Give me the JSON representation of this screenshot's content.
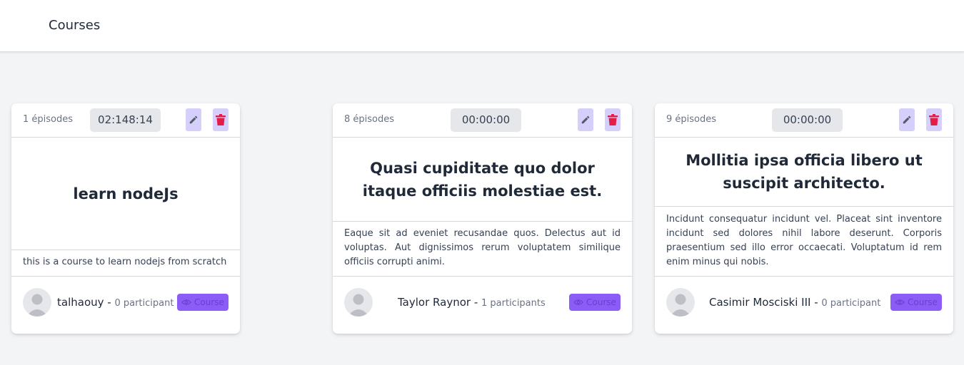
{
  "header": {
    "title": "Courses"
  },
  "colors": {
    "accent": "#8b5cf6",
    "delete": "#e11d48",
    "icon_bg": "#d4d0fb"
  },
  "icons": {
    "edit": "pencil-icon",
    "delete": "trash-icon",
    "view": "eye-icon",
    "avatar": "user-avatar-icon"
  },
  "courses": [
    {
      "episodes": "1 épisodes",
      "duration": "02:148:14",
      "title": "learn nodeJs",
      "description": "this is a course to learn nodejs from scratch",
      "author": "talhaouy",
      "separator": " - ",
      "participants": "0 participant",
      "button_label": "Course"
    },
    {
      "episodes": "8 épisodes",
      "duration": "00:00:00",
      "title": "Quasi cupiditate quo dolor itaque officiis molestiae est.",
      "description": "Eaque sit ad eveniet recusandae quos. Delectus aut id voluptas. Aut dignissimos rerum voluptatem similique officiis corrupti animi.",
      "author": "Taylor Raynor",
      "separator": " - ",
      "participants": "1 participants",
      "button_label": "Course"
    },
    {
      "episodes": "9 épisodes",
      "duration": "00:00:00",
      "title": "Mollitia ipsa officia libero ut suscipit architecto.",
      "description": "Incidunt consequatur incidunt vel. Placeat sint inventore incidunt sed dolores nihil labore deserunt. Corporis praesentium sed illo error occaecati. Voluptatum id rem enim minus qui nobis.",
      "author": "Casimir Mosciski III",
      "separator": " - ",
      "participants": "0 participant",
      "button_label": "Course"
    }
  ]
}
